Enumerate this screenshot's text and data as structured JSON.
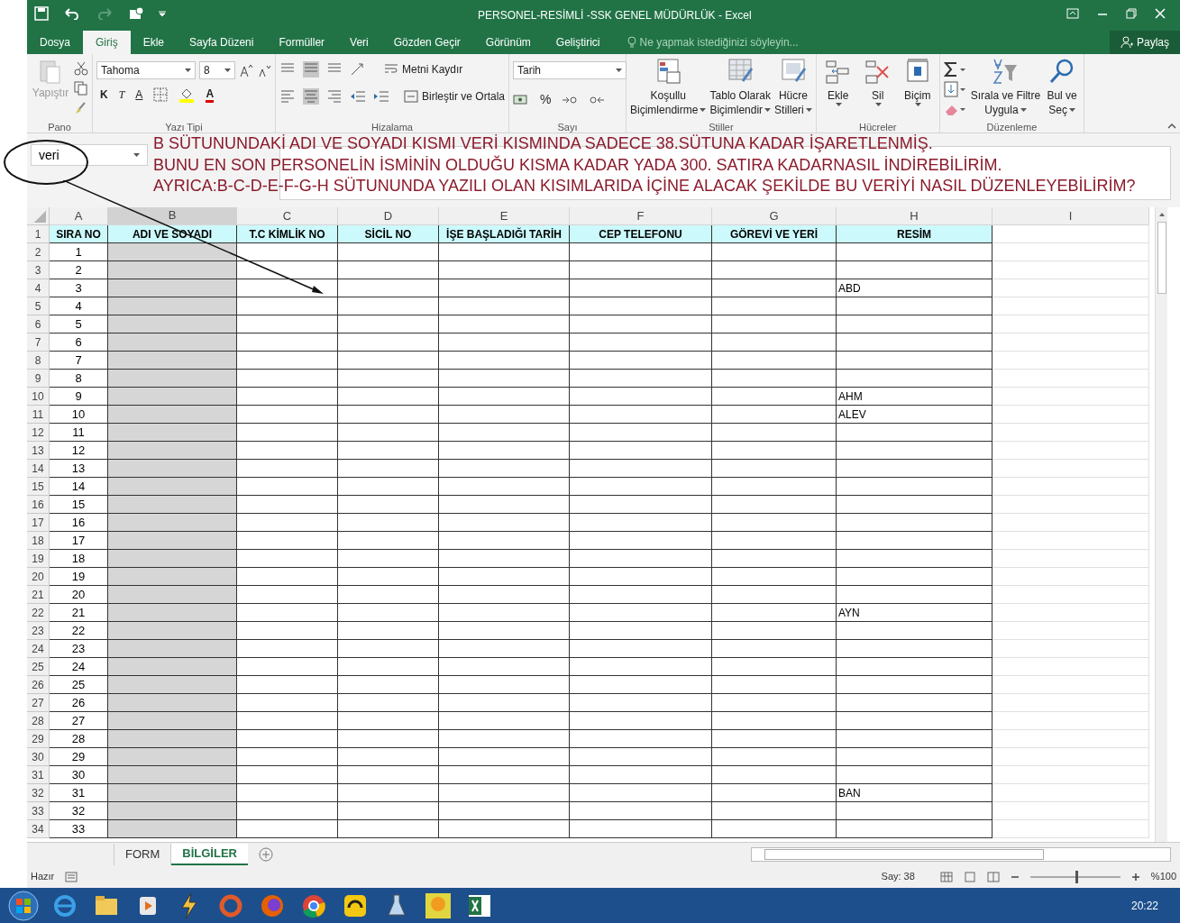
{
  "window": {
    "title": "PERSONEL-RESİMLİ -SSK GENEL MÜDÜRLÜK - Excel"
  },
  "tabs": [
    {
      "label": "Dosya",
      "selected": false
    },
    {
      "label": "Giriş",
      "selected": true
    },
    {
      "label": "Ekle",
      "selected": false
    },
    {
      "label": "Sayfa Düzeni",
      "selected": false
    },
    {
      "label": "Formüller",
      "selected": false
    },
    {
      "label": "Veri",
      "selected": false
    },
    {
      "label": "Gözden Geçir",
      "selected": false
    },
    {
      "label": "Görünüm",
      "selected": false
    },
    {
      "label": "Geliştirici",
      "selected": false
    }
  ],
  "tell_me": {
    "placeholder": "Ne yapmak istediğinizi söyleyin..."
  },
  "share": "Paylaş",
  "ribbon": {
    "paste": "Yapıştır",
    "font": "Tahoma",
    "size": "8",
    "bold": "K",
    "italic": "T",
    "underline": "A",
    "font_color": "A",
    "wrap": "Metni Kaydır",
    "merge": "Birleştir ve Ortala",
    "number_format": "Tarih",
    "percent": "%",
    "styles": [
      {
        "line1": "Koşullu",
        "line2": "Biçimlendirme"
      },
      {
        "line1": "Tablo Olarak",
        "line2": "Biçimlendir"
      },
      {
        "line1": "Hücre",
        "line2": "Stilleri"
      }
    ],
    "cells": [
      "Ekle",
      "Sil",
      "Biçim"
    ],
    "editing": [
      {
        "line1": "Sırala ve Filtre",
        "line2": "Uygula"
      },
      {
        "line1": "Bul ve",
        "line2": "Seç"
      }
    ],
    "groups": [
      "Pano",
      "Yazı Tipi",
      "Hizalama",
      "Sayı",
      "Stiller",
      "Hücreler",
      "Düzenleme"
    ]
  },
  "name_box": "veri",
  "note": [
    "B SÜTUNUNDAKİ ADI VE SOYADI KISMI VERİ KISMINDA SADECE 38.SÜTUNA KADAR İŞARETLENMİŞ.",
    "BUNU EN SON PERSONELİN İSMİNİN OLDUĞU KISMA KADAR YADA 300. SATIRA KADARNASIL İNDİREBİLİRİM.",
    "AYRICA:B-C-D-E-F-G-H SÜTUNUNDA YAZILI OLAN KISIMLARIDA İÇİNE ALACAK ŞEKİLDE BU VERİYİ NASIL DÜZENLEYEBİLİRİM?"
  ],
  "columns": [
    "A",
    "B",
    "C",
    "D",
    "E",
    "F",
    "G",
    "H",
    "I"
  ],
  "headers": [
    "SIRA NO",
    "ADI VE SOYADI",
    "T.C KİMLİK NO",
    "SİCİL NO",
    "İŞE BAŞLADIĞI TARİH",
    "CEP TELEFONU",
    "GÖREVİ VE YERİ",
    "RESİM"
  ],
  "header_row_number": "1",
  "rows": [
    {
      "row": "2",
      "no": "1"
    },
    {
      "row": "3",
      "no": "2"
    },
    {
      "row": "4",
      "no": "3",
      "resim": "ABD"
    },
    {
      "row": "5",
      "no": "4"
    },
    {
      "row": "6",
      "no": "5"
    },
    {
      "row": "7",
      "no": "6"
    },
    {
      "row": "8",
      "no": "7"
    },
    {
      "row": "9",
      "no": "8"
    },
    {
      "row": "10",
      "no": "9",
      "resim": "AHM"
    },
    {
      "row": "11",
      "no": "10",
      "resim": "ALEV"
    },
    {
      "row": "12",
      "no": "11"
    },
    {
      "row": "13",
      "no": "12"
    },
    {
      "row": "14",
      "no": "13"
    },
    {
      "row": "15",
      "no": "14"
    },
    {
      "row": "16",
      "no": "15"
    },
    {
      "row": "17",
      "no": "16"
    },
    {
      "row": "18",
      "no": "17"
    },
    {
      "row": "19",
      "no": "18"
    },
    {
      "row": "20",
      "no": "19"
    },
    {
      "row": "21",
      "no": "20"
    },
    {
      "row": "22",
      "no": "21",
      "resim": "AYN"
    },
    {
      "row": "23",
      "no": "22"
    },
    {
      "row": "24",
      "no": "23"
    },
    {
      "row": "25",
      "no": "24"
    },
    {
      "row": "26",
      "no": "25"
    },
    {
      "row": "27",
      "no": "26"
    },
    {
      "row": "28",
      "no": "27"
    },
    {
      "row": "29",
      "no": "28"
    },
    {
      "row": "30",
      "no": "29"
    },
    {
      "row": "31",
      "no": "30"
    },
    {
      "row": "32",
      "no": "31",
      "resim": "BAN"
    },
    {
      "row": "33",
      "no": "32"
    },
    {
      "row": "34",
      "no": "33"
    }
  ],
  "sheets": [
    {
      "label": "FORM",
      "selected": false
    },
    {
      "label": "BİLGİLER",
      "selected": true
    }
  ],
  "status_bar": {
    "ready": "Hazır",
    "count": "Say: 38",
    "zoom": "%100",
    "level": 0.5
  },
  "taskbar": {
    "time": "20:22"
  }
}
